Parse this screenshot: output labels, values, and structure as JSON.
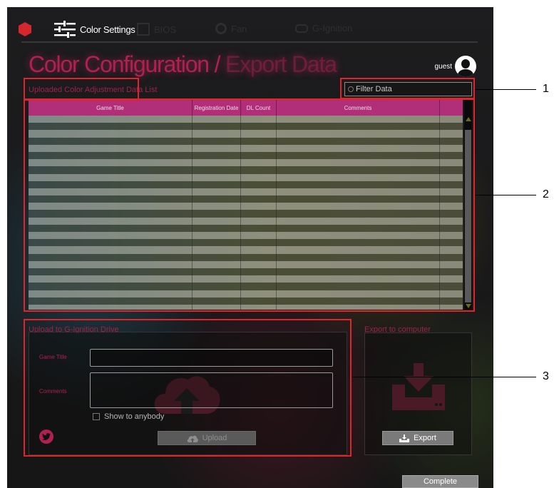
{
  "nav": {
    "active_label": "Color Settings",
    "faded_1": "BIOS",
    "faded_2": "Fan",
    "faded_3": "G-Ignition"
  },
  "page": {
    "title_main": "Color Configuration / ",
    "title_dim": "Export Data"
  },
  "user": {
    "name": "guest"
  },
  "list": {
    "title": "Uploaded Color Adjustment Data List",
    "filter_placeholder": "Filter Data",
    "columns": [
      "Game Title",
      "Registration Date",
      "DL Count",
      "Comments",
      ""
    ]
  },
  "upload": {
    "title": "Upload to G-Ignition Drive",
    "game_title_label": "Game Title",
    "comments_label": "Comments",
    "show_to_anybody": "Show to anybody",
    "button": "Upload"
  },
  "export": {
    "title": "Export to computer",
    "button": "Export"
  },
  "complete_button": "Complete",
  "callouts": [
    "1",
    "2",
    "3"
  ],
  "colors": {
    "accent": "#b0214f",
    "header_pink": "#b12f79",
    "callout_red": "#e0242c"
  }
}
